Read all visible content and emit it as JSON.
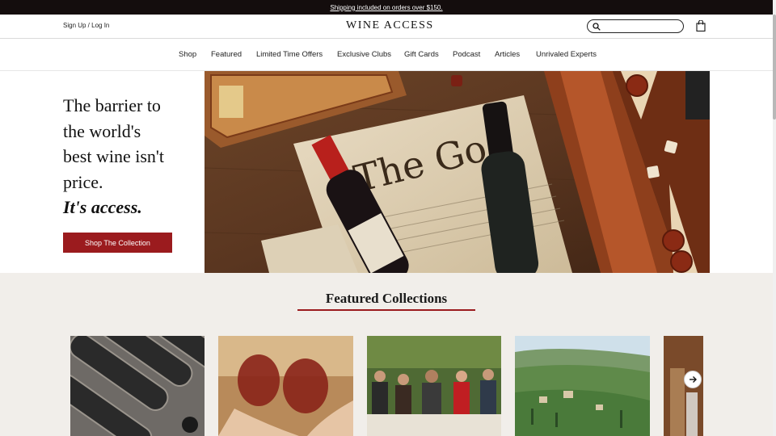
{
  "promo": {
    "text": "Shipping included on orders over $150."
  },
  "header": {
    "auth": "Sign Up / Log In",
    "logo": "WINE ACCESS",
    "search_placeholder": ""
  },
  "nav": {
    "items": [
      "Shop",
      "Featured",
      "Limited Time Offers",
      "Exclusive Clubs",
      "Gift Cards",
      "Podcast",
      "Articles",
      "Unrivaled Experts"
    ]
  },
  "hero": {
    "line1": "The barrier to",
    "line2": "the world's",
    "line3": "best wine isn't",
    "line4": "price.",
    "accent": "It's access.",
    "cta": "Shop The Collection"
  },
  "featured": {
    "title": "Featured Collections"
  },
  "colors": {
    "promo_bg": "#140d0d",
    "brand_red": "#9b1b1e",
    "section_bg": "#f1eeea"
  },
  "icons": {
    "search": "search-icon",
    "cart": "shopping-bag-icon",
    "next": "arrow-right-icon"
  }
}
